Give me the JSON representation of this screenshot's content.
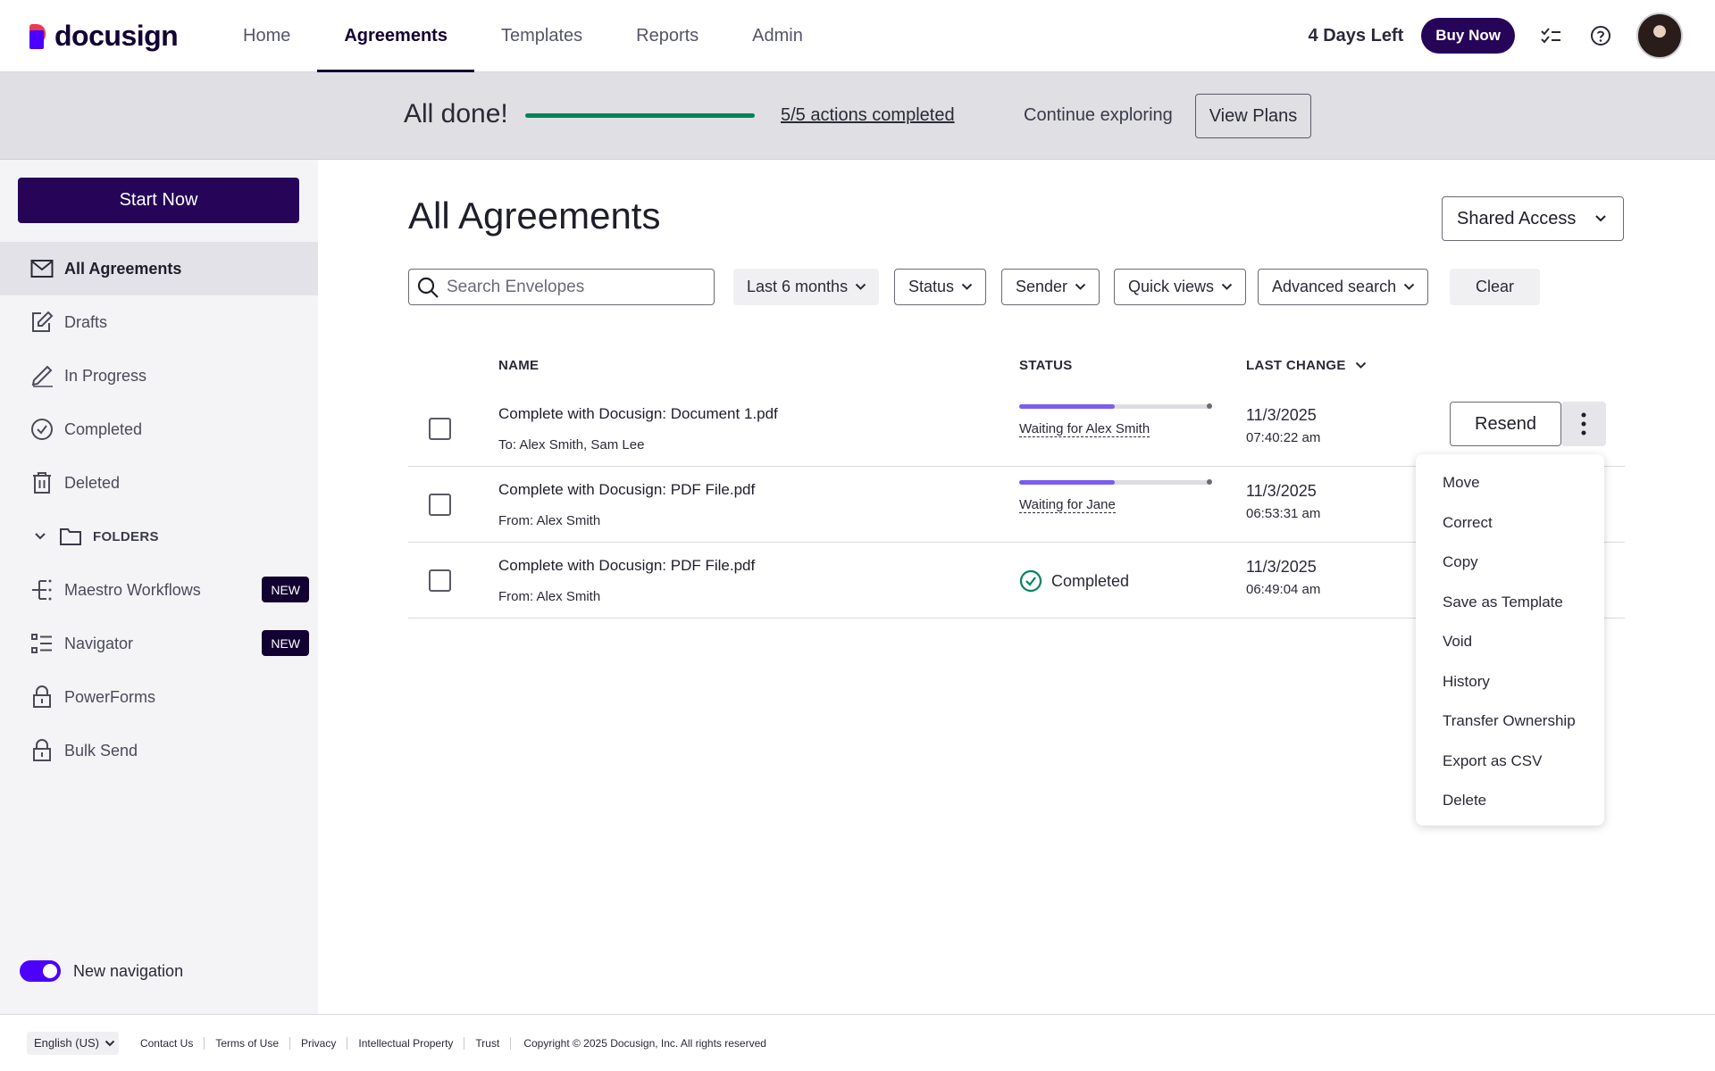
{
  "brand": {
    "name": "docusign"
  },
  "nav": {
    "tabs": [
      {
        "label": "Home"
      },
      {
        "label": "Agreements"
      },
      {
        "label": "Templates"
      },
      {
        "label": "Reports"
      },
      {
        "label": "Admin"
      }
    ],
    "active_tab": "Agreements",
    "days_left": "4 Days Left",
    "buy_now": "Buy Now"
  },
  "banner": {
    "title": "All done!",
    "progress": 1.0,
    "actions_link": "5/5 actions completed",
    "continue_text": "Continue exploring",
    "view_plans": "View Plans"
  },
  "sidebar": {
    "start_now": "Start Now",
    "items": [
      {
        "label": "All Agreements",
        "icon": "envelope-icon"
      },
      {
        "label": "Drafts",
        "icon": "draft-icon"
      },
      {
        "label": "In Progress",
        "icon": "pen-icon"
      },
      {
        "label": "Completed",
        "icon": "check-circle-icon"
      },
      {
        "label": "Deleted",
        "icon": "trash-icon"
      }
    ],
    "folders_label": "FOLDERS",
    "extra_items": [
      {
        "label": "Maestro Workflows",
        "badge": "NEW"
      },
      {
        "label": "Navigator",
        "badge": "NEW"
      },
      {
        "label": "PowerForms",
        "badge": ""
      },
      {
        "label": "Bulk Send",
        "badge": ""
      }
    ],
    "new_navigation": "New navigation",
    "new_navigation_on": true
  },
  "main": {
    "title": "All Agreements",
    "shared_access": "Shared Access",
    "search_placeholder": "Search Envelopes",
    "filters": {
      "date": "Last 6 months",
      "status": "Status",
      "sender": "Sender",
      "quick_views": "Quick views",
      "advanced": "Advanced search",
      "clear": "Clear"
    },
    "columns": {
      "name": "NAME",
      "status": "STATUS",
      "last_change": "LAST CHANGE"
    },
    "rows": [
      {
        "name": "Complete with Docusign: Document 1.pdf",
        "sub": "To: Alex Smith, Sam Lee",
        "status": "Waiting for Alex Smith",
        "progress": 0.5,
        "date": "11/3/2025",
        "time": "07:40:22 am",
        "action": "Resend"
      },
      {
        "name": "Complete with Docusign: PDF File.pdf",
        "sub": "From: Alex Smith",
        "status": "Waiting for Jane",
        "progress": 0.5,
        "date": "11/3/2025",
        "time": "06:53:31 am"
      },
      {
        "name": "Complete with Docusign: PDF File.pdf",
        "sub": "From: Alex Smith",
        "status": "Completed",
        "date": "11/3/2025",
        "time": "06:49:04 am"
      }
    ]
  },
  "context_menu": {
    "items": [
      "Move",
      "Correct",
      "Copy",
      "Save as Template",
      "Void",
      "History",
      "Transfer Ownership",
      "Export as CSV",
      "Delete"
    ]
  },
  "footer": {
    "language": "English (US)",
    "links": [
      "Contact Us",
      "Terms of Use",
      "Privacy",
      "Intellectual Property",
      "Trust"
    ],
    "copyright": "Copyright © 2025 Docusign, Inc. All rights reserved"
  },
  "colors": {
    "brand_dark": "#260559",
    "accent": "#4c00ff",
    "success": "#00855a",
    "progress": "#7a5cf0"
  }
}
